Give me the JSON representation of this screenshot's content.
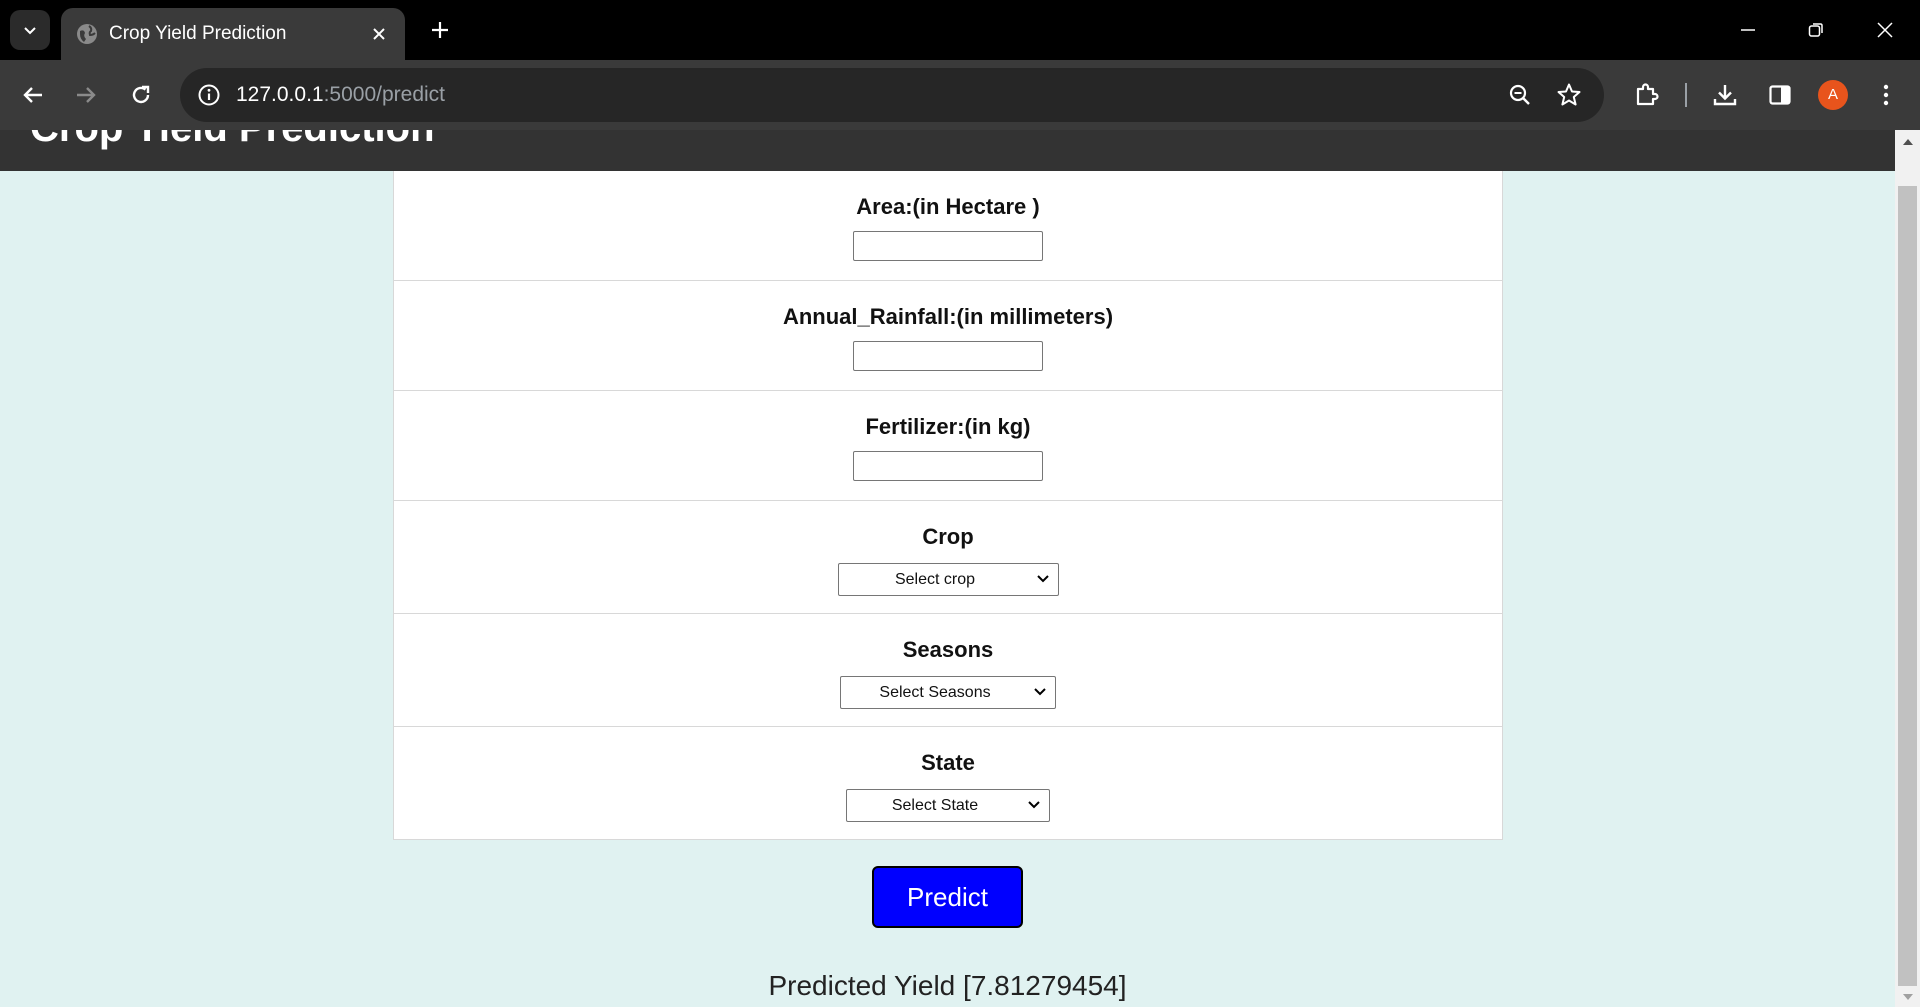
{
  "browser": {
    "tab": {
      "title": "Crop Yield Prediction",
      "favicon": "globe-icon"
    },
    "address": {
      "host": "127.0.0.1",
      "rest": ":5000/predict"
    },
    "profile_initial": "A",
    "colors": {
      "profile": "#e8541c"
    }
  },
  "page": {
    "header_title": "Crop Yield Prediction",
    "fields": {
      "area_label": "Area:(in Hectare )",
      "rainfall_label": "Annual_Rainfall:(in millimeters)",
      "fertilizer_label": "Fertilizer:(in kg)",
      "crop_label": "Crop",
      "crop_selected": "Select crop",
      "seasons_label": "Seasons",
      "seasons_selected": "Select Seasons",
      "state_label": "State",
      "state_selected": "Select State"
    },
    "predict_label": "Predict",
    "result_text": "Predicted Yield [7.81279454]",
    "colors": {
      "background": "#e0f2f1",
      "header": "#333333",
      "predict_button": "#0000ff"
    }
  }
}
